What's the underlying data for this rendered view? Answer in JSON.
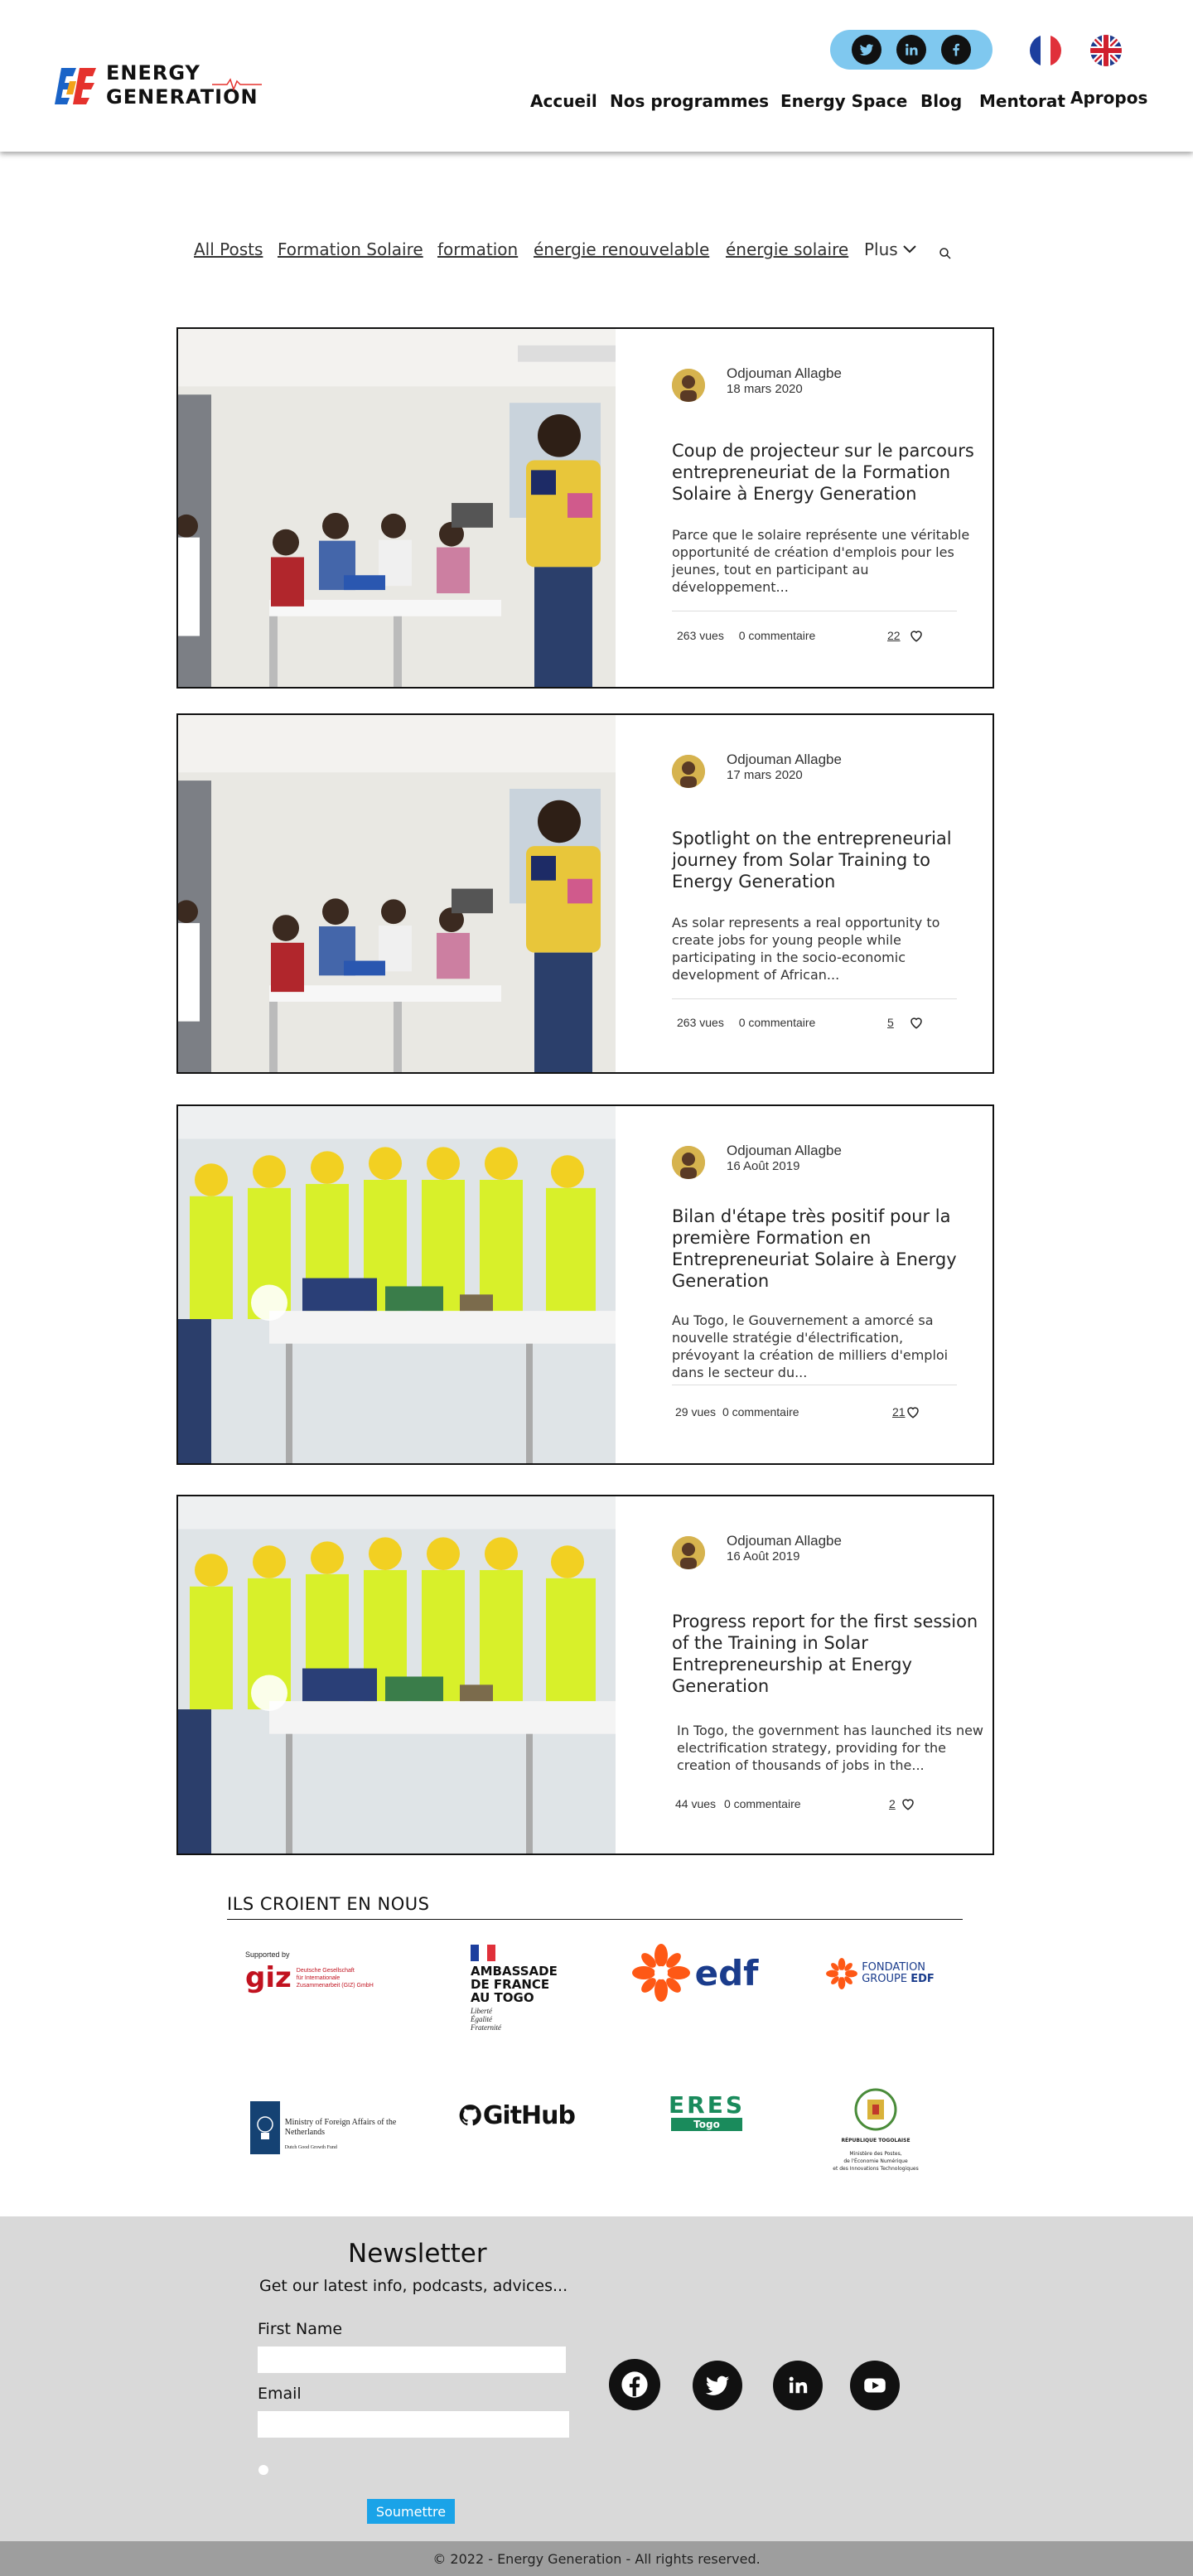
{
  "brand": {
    "name_line1": "ENERGY",
    "name_line2": "GENERATION"
  },
  "social_header": [
    "twitter-icon",
    "linkedin-icon",
    "facebook-icon"
  ],
  "languages": [
    "fr-flag",
    "uk-flag"
  ],
  "nav": [
    "Accueil",
    "Nos programmes",
    "Energy Space",
    "Blog",
    "Mentorat",
    "Apropos"
  ],
  "categories": [
    "All Posts",
    "Formation Solaire",
    "formation",
    "énergie renouvelable",
    "énergie solaire"
  ],
  "categories_more": "Plus",
  "posts": [
    {
      "author": "Odjouman Allagbe",
      "date": "18 mars 2020",
      "title": "Coup de projecteur sur le parcours entrepreneuriat de la Formation Solaire à Energy Generation",
      "excerpt": "Parce que le solaire représente une véritable opportunité de création d'emplois pour les jeunes, tout en participant au développement...",
      "views": "263 vues",
      "comments": "0 commentaire",
      "likes": "22"
    },
    {
      "author": "Odjouman Allagbe",
      "date": "17 mars 2020",
      "title": "Spotlight on the entrepreneurial journey from Solar Training to Energy Generation",
      "excerpt": "As solar represents a real opportunity to create jobs for young people while participating in the socio-economic development of African...",
      "views": "263 vues",
      "comments": "0 commentaire",
      "likes": "5"
    },
    {
      "author": "Odjouman Allagbe",
      "date": "16 Août 2019",
      "title": "Bilan d'étape très positif pour la première Formation en Entrepreneuriat Solaire à Energy Generation",
      "excerpt": "Au Togo, le Gouvernement a amorcé sa nouvelle stratégie d'électrification, prévoyant la création de milliers d'emploi dans le secteur du...",
      "views": "29 vues",
      "comments": "0 commentaire",
      "likes": "21"
    },
    {
      "author": "Odjouman Allagbe",
      "date": "16 Août 2019",
      "title": "Progress report for the first session of the Training in Solar Entrepreneurship at Energy Generation",
      "excerpt": "In Togo, the government has launched its new electrification strategy, providing for the creation of thousands of jobs in the...",
      "views": "44 vues",
      "comments": "0 commentaire",
      "likes": "2"
    }
  ],
  "partners": {
    "title": "ILS CROIENT EN NOUS",
    "giz": {
      "supported": "Supported by",
      "name": "giz",
      "sub1": "Deutsche Gesellschaft",
      "sub2": "für Internationale",
      "sub3": "Zusammenarbeit (GIZ) GmbH"
    },
    "ambassade": {
      "l1": "AMBASSADE",
      "l2": "DE FRANCE",
      "l3": "AU TOGO",
      "m1": "Liberté",
      "m2": "Égalité",
      "m3": "Fraternité"
    },
    "edf": "edf",
    "fondation": {
      "l1": "FONDATION",
      "l2": "GROUPE",
      "l3": "EDF"
    },
    "netherlands": {
      "l1": "Ministry of Foreign Affairs of the",
      "l2": "Netherlands",
      "l3": "Dutch Good Growth Fund"
    },
    "github": "GitHub",
    "eres": {
      "name": "ERES",
      "sub": "Togo"
    },
    "togo": {
      "l1": "RÉPUBLIQUE TOGOLAISE",
      "l2": "Ministère des Postes,",
      "l3": "de l'Économie Numérique",
      "l4": "et des Innovations Technologiques"
    }
  },
  "newsletter": {
    "title": "Newsletter",
    "subtitle": "Get our latest info, podcasts, advices...",
    "first_name_label": "First Name",
    "email_label": "Email",
    "submit": "Soumettre"
  },
  "footer_social": [
    "facebook-icon",
    "twitter-icon",
    "linkedin-icon",
    "youtube-icon"
  ],
  "copyright": "© 2022 - Energy Generation - All rights reserved.",
  "colors": {
    "social_pill": "#7fc8ef",
    "submit": "#1aa3e8",
    "newsletter_bg": "#d9d9d9",
    "footer_bar": "#9e9e9e",
    "edf_orange": "#fe5815",
    "edf_blue": "#1a3c8c"
  }
}
